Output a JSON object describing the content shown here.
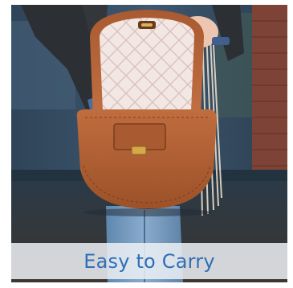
{
  "caption": {
    "text": "Easy to Carry",
    "color": "#2f6fb6"
  },
  "photo": {
    "subject": "brown-leather-handbag-icon",
    "colors": {
      "leather": "#b5643a",
      "quilted_lining": "#f1e3e0",
      "wall_blue": "#3b5369",
      "brick": "#8a4a3a",
      "jacket": "#2c2f33",
      "denim": "#6e93b8"
    }
  }
}
